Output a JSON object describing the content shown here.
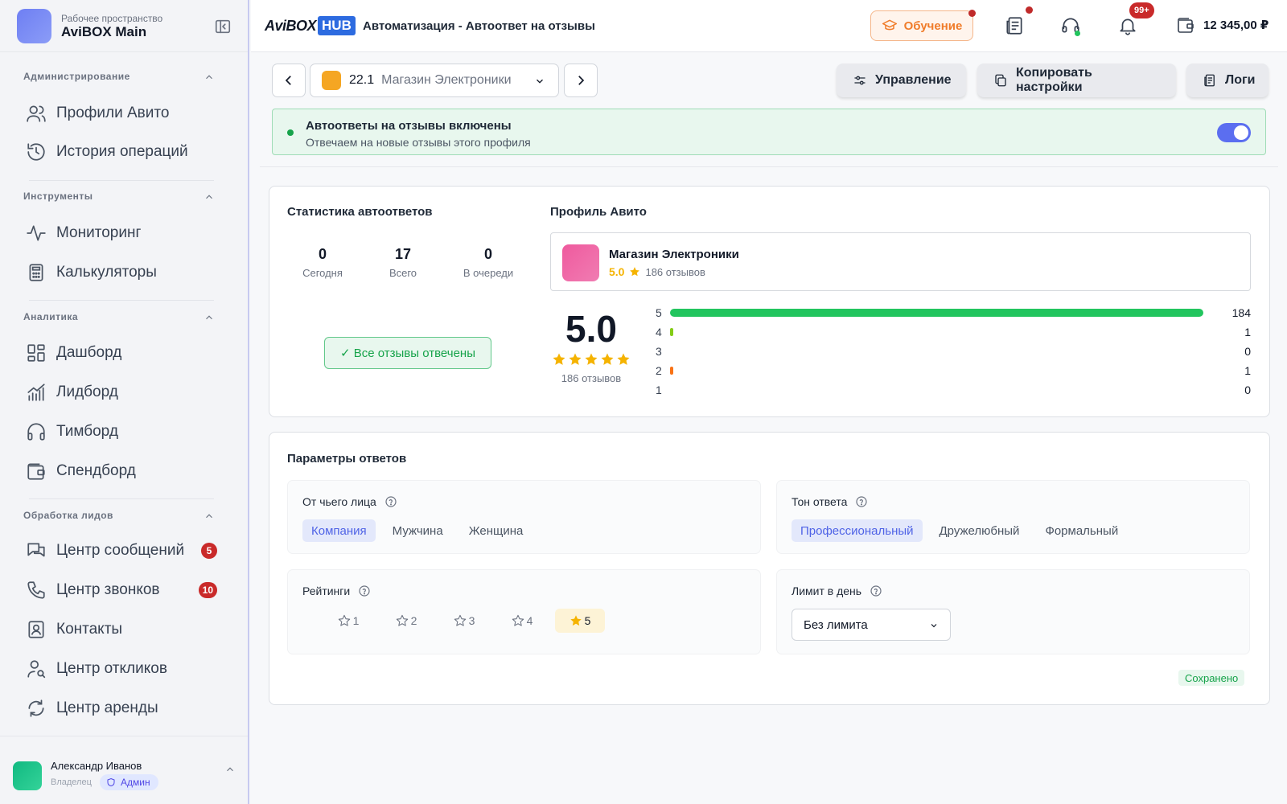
{
  "workspace": {
    "subtitle": "Рабочее пространство",
    "title": "AviBOX Main"
  },
  "sidebar": {
    "sections": [
      {
        "title": "Администрирование",
        "items": [
          {
            "label": "Профили Авито",
            "icon": "users-icon"
          },
          {
            "label": "История операций",
            "icon": "history-icon"
          }
        ]
      },
      {
        "title": "Инструменты",
        "items": [
          {
            "label": "Мониторинг",
            "icon": "activity-icon"
          },
          {
            "label": "Калькуляторы",
            "icon": "calculator-icon"
          }
        ]
      },
      {
        "title": "Аналитика",
        "items": [
          {
            "label": "Дашборд",
            "icon": "dashboard-icon"
          },
          {
            "label": "Лидборд",
            "icon": "chart-icon"
          },
          {
            "label": "Тимборд",
            "icon": "headphones-icon"
          },
          {
            "label": "Спендборд",
            "icon": "wallet-icon"
          }
        ]
      },
      {
        "title": "Обработка лидов",
        "items": [
          {
            "label": "Центр сообщений",
            "icon": "messages-icon",
            "badge": "5"
          },
          {
            "label": "Центр звонков",
            "icon": "phone-icon",
            "badge": "10"
          },
          {
            "label": "Контакты",
            "icon": "contacts-icon"
          },
          {
            "label": "Центр откликов",
            "icon": "user-search-icon"
          },
          {
            "label": "Центр аренды",
            "icon": "refresh-icon"
          }
        ]
      }
    ]
  },
  "user": {
    "name": "Александр Иванов",
    "role": "Владелец",
    "badge": "Админ"
  },
  "header": {
    "logo_left": "AviBOX",
    "logo_right": "HUB",
    "title": "Автоматизация - Автоответ на отзывы",
    "learn_label": "Обучение",
    "notifications_badge": "99+",
    "balance": "12 345,00 ₽"
  },
  "toolbar": {
    "profile_number": "22.1",
    "profile_name": "Магазин Электроники",
    "manage_label": "Управление",
    "copy_label": "Копировать настройки",
    "logs_label": "Логи"
  },
  "banner": {
    "title": "Автоответы на отзывы включены",
    "subtitle": "Отвечаем на новые отзывы этого профиля",
    "enabled": true
  },
  "stats": {
    "title": "Статистика автоответов",
    "items": [
      {
        "value": "0",
        "label": "Сегодня"
      },
      {
        "value": "17",
        "label": "Всего"
      },
      {
        "value": "0",
        "label": "В очереди"
      }
    ],
    "status_label": "✓ Все отзывы отвечены"
  },
  "profile": {
    "title": "Профиль Авито",
    "name": "Магазин Электроники",
    "rating": "5.0",
    "reviews": "186 отзывов",
    "big_rating": "5.0",
    "big_reviews": "186 отзывов",
    "distribution": [
      {
        "stars": "5",
        "count": "184",
        "share": 0.989,
        "color": "#22c55e"
      },
      {
        "stars": "4",
        "count": "1",
        "share": 0.005,
        "color": "#84cc16"
      },
      {
        "stars": "3",
        "count": "0",
        "share": 0,
        "color": "#eab308"
      },
      {
        "stars": "2",
        "count": "1",
        "share": 0.005,
        "color": "#f97316"
      },
      {
        "stars": "1",
        "count": "0",
        "share": 0,
        "color": "#ef4444"
      }
    ]
  },
  "params": {
    "title": "Параметры ответов",
    "face": {
      "label": "От чьего лица",
      "options": [
        "Компания",
        "Мужчина",
        "Женщина"
      ],
      "selected": 0
    },
    "tone": {
      "label": "Тон ответа",
      "options": [
        "Профессиональный",
        "Дружелюбный",
        "Формальный"
      ],
      "selected": 0
    },
    "ratings": {
      "label": "Рейтинги",
      "options": [
        "1",
        "2",
        "3",
        "4",
        "5"
      ],
      "selected": [
        4
      ]
    },
    "limit": {
      "label": "Лимит в день",
      "value": "Без лимита"
    },
    "saved_label": "Сохранено"
  },
  "colors": {
    "accent": "#5b6ef0",
    "success": "#16a34a",
    "danger": "#c92a2a",
    "star": "#f5b300"
  }
}
